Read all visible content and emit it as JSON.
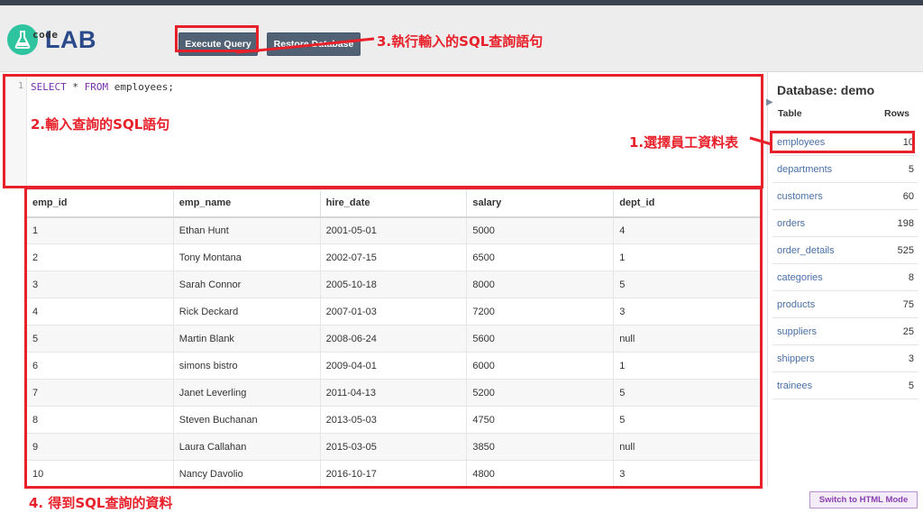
{
  "app": {
    "logo_code": "code",
    "logo_lab": "LAB"
  },
  "toolbar": {
    "execute_label": "Execute Query",
    "restore_label": "Restore Database"
  },
  "editor": {
    "line_number": "1",
    "kw_select": "SELECT",
    "star": " * ",
    "kw_from": "FROM",
    "table_ref": " employees;"
  },
  "results": {
    "columns": [
      "emp_id",
      "emp_name",
      "hire_date",
      "salary",
      "dept_id"
    ],
    "rows": [
      [
        "1",
        "Ethan Hunt",
        "2001-05-01",
        "5000",
        "4"
      ],
      [
        "2",
        "Tony Montana",
        "2002-07-15",
        "6500",
        "1"
      ],
      [
        "3",
        "Sarah Connor",
        "2005-10-18",
        "8000",
        "5"
      ],
      [
        "4",
        "Rick Deckard",
        "2007-01-03",
        "7200",
        "3"
      ],
      [
        "5",
        "Martin Blank",
        "2008-06-24",
        "5600",
        "null"
      ],
      [
        "6",
        "simons bistro",
        "2009-04-01",
        "6000",
        "1"
      ],
      [
        "7",
        "Janet Leverling",
        "2011-04-13",
        "5200",
        "5"
      ],
      [
        "8",
        "Steven Buchanan",
        "2013-05-03",
        "4750",
        "5"
      ],
      [
        "9",
        "Laura Callahan",
        "2015-03-05",
        "3850",
        "null"
      ],
      [
        "10",
        "Nancy Davolio",
        "2016-10-17",
        "4800",
        "3"
      ]
    ]
  },
  "sidebar": {
    "title": "Database: demo",
    "col_table": "Table",
    "col_rows": "Rows",
    "tables": [
      {
        "name": "employees",
        "rows": "10"
      },
      {
        "name": "departments",
        "rows": "5"
      },
      {
        "name": "customers",
        "rows": "60"
      },
      {
        "name": "orders",
        "rows": "198"
      },
      {
        "name": "order_details",
        "rows": "525"
      },
      {
        "name": "categories",
        "rows": "8"
      },
      {
        "name": "products",
        "rows": "75"
      },
      {
        "name": "suppliers",
        "rows": "25"
      },
      {
        "name": "shippers",
        "rows": "3"
      },
      {
        "name": "trainees",
        "rows": "5"
      }
    ]
  },
  "footer": {
    "switch_label": "Switch to HTML Mode"
  },
  "annotations": {
    "step1": "1.選擇員工資料表",
    "step2": "2.輸入查詢的SQL語句",
    "step3": "3.執行輸入的SQL查詢語句",
    "step4": "4. 得到SQL查詢的資料"
  },
  "colors": {
    "annotation": "#e8202a",
    "button": "#516275",
    "logo_accent": "#2ec4a0",
    "link": "#4a6fa5"
  }
}
